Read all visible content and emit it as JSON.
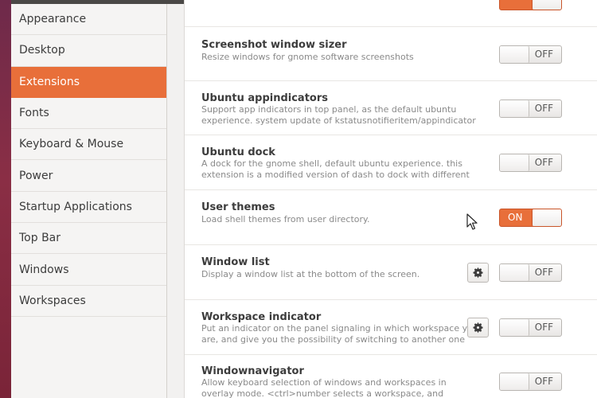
{
  "sidebar": {
    "items": [
      {
        "label": "Appearance"
      },
      {
        "label": "Desktop"
      },
      {
        "label": "Extensions",
        "selected": true
      },
      {
        "label": "Fonts"
      },
      {
        "label": "Keyboard & Mouse"
      },
      {
        "label": "Power"
      },
      {
        "label": "Startup Applications"
      },
      {
        "label": "Top Bar"
      },
      {
        "label": "Windows"
      },
      {
        "label": "Workspaces"
      }
    ]
  },
  "extensions": [
    {
      "title": "Screenshot window sizer",
      "desc": "Resize windows for gnome software screenshots",
      "state": "OFF",
      "has_settings": false
    },
    {
      "title": "Ubuntu appindicators",
      "desc": "Support app indicators in top panel, as the default ubuntu experience. system update of kstatusnotifieritem/appindicator support",
      "state": "OFF",
      "has_settings": false
    },
    {
      "title": "Ubuntu dock",
      "desc": "A dock for the gnome shell, default ubuntu experience. this extension is a modified version of dash to dock with different defaults",
      "state": "OFF",
      "has_settings": false
    },
    {
      "title": "User themes",
      "desc": "Load shell themes from user directory.",
      "state": "ON",
      "has_settings": false
    },
    {
      "title": "Window list",
      "desc": "Display a window list at the bottom of the screen.",
      "state": "OFF",
      "has_settings": true
    },
    {
      "title": "Workspace indicator",
      "desc": "Put an indicator on the panel signaling in which workspace you are, and give you the possibility of switching to another one",
      "state": "OFF",
      "has_settings": true
    },
    {
      "title": "Windownavigator",
      "desc": "Allow keyboard selection of windows and workspaces in overlay mode. <ctrl>number selects a workspace, and <alt>number selects a window.",
      "state": "OFF",
      "has_settings": false
    }
  ],
  "colors": {
    "accent": "#e86f3a",
    "window_bg": "#f2f1f0",
    "list_bg": "#ffffff",
    "text": "#3c3c3c",
    "muted": "#8a8a8a"
  },
  "icons": {
    "settings": "gear-icon",
    "pointer": "mouse-cursor-icon"
  }
}
